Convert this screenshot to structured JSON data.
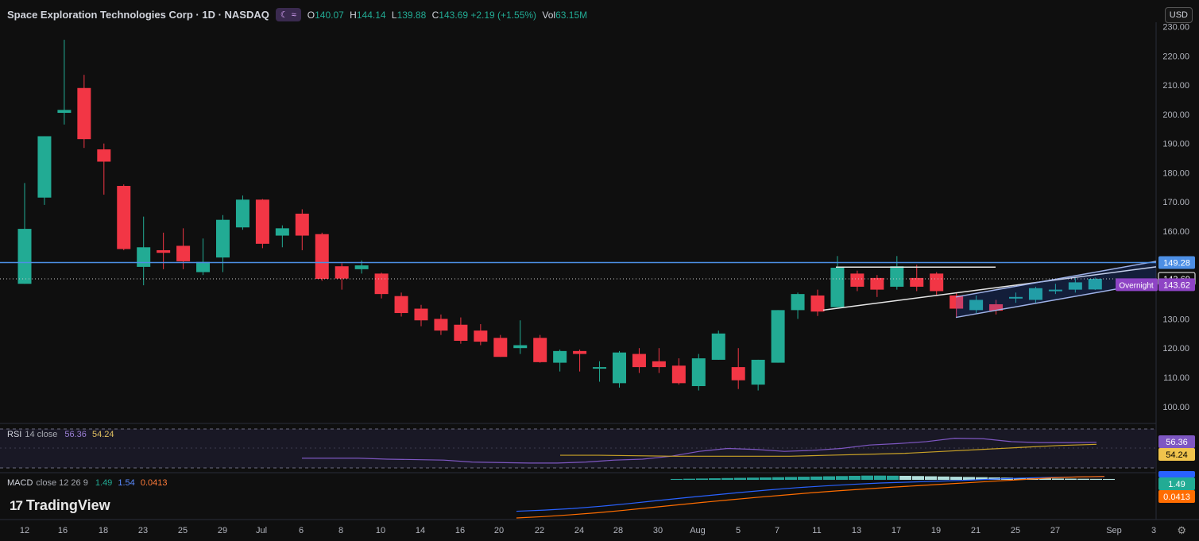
{
  "header": {
    "title": "Space Exploration Technologies Corp · 1D · NASDAQ",
    "ohlc": [
      {
        "k": "O",
        "v": "140.07"
      },
      {
        "k": "H",
        "v": "144.14"
      },
      {
        "k": "L",
        "v": "139.88"
      },
      {
        "k": "C",
        "v": "143.69 +2.19 (+1.55%)"
      },
      {
        "k": "Vol",
        "v": "63.15M"
      }
    ]
  },
  "currency": "USD",
  "brand": "TradingView",
  "rsi": {
    "name": "RSI",
    "params": "14 close",
    "rsi_value": "56.36",
    "ma_value": "54.24"
  },
  "macd": {
    "name": "MACD",
    "params": "close 12 26 9",
    "macd_value": "1.49",
    "signal_value": "1.54",
    "hist_value": "0.0413"
  },
  "colors": {
    "up": "#22ab94",
    "down": "#f23645",
    "level": "#4d8fe5",
    "rsi": "#7e57c2",
    "rsi_ma": "#c9a227",
    "macd": "#2962ff",
    "signal": "#ff6d00"
  },
  "chart_data": {
    "type": "candlestick",
    "ylim": [
      94.5,
      231.5
    ],
    "y_ticks": [
      "230.00",
      "220.00",
      "210.00",
      "200.00",
      "190.00",
      "180.00",
      "170.00",
      "160.00",
      "150.00",
      "130.00",
      "120.00",
      "110.00",
      "100.00"
    ],
    "x_ticks": [
      "12",
      "16",
      "18",
      "23",
      "25",
      "29",
      "Jul",
      "6",
      "8",
      "10",
      "14",
      "16",
      "20",
      "22",
      "24",
      "28",
      "30",
      "Aug",
      "5",
      "7",
      "11",
      "13",
      "17",
      "19",
      "21",
      "25",
      "27",
      "Sep",
      "3"
    ],
    "candles": [
      {
        "o": 142.0,
        "h": 176.5,
        "l": 142.0,
        "c": 160.8
      },
      {
        "o": 171.5,
        "h": 192.5,
        "l": 169.0,
        "c": 192.5
      },
      {
        "o": 200.5,
        "h": 225.5,
        "l": 196.5,
        "c": 201.5
      },
      {
        "o": 209.0,
        "h": 213.5,
        "l": 188.5,
        "c": 191.5
      },
      {
        "o": 188.0,
        "h": 190.0,
        "l": 172.5,
        "c": 183.8
      },
      {
        "o": 175.5,
        "h": 176.0,
        "l": 153.5,
        "c": 153.9
      },
      {
        "o": 147.8,
        "h": 165.0,
        "l": 141.5,
        "c": 154.5
      },
      {
        "o": 153.5,
        "h": 159.5,
        "l": 147.0,
        "c": 152.6
      },
      {
        "o": 155.0,
        "h": 161.0,
        "l": 147.0,
        "c": 149.7
      },
      {
        "o": 146.0,
        "h": 157.5,
        "l": 145.0,
        "c": 149.5
      },
      {
        "o": 151.0,
        "h": 165.5,
        "l": 146.0,
        "c": 163.9
      },
      {
        "o": 161.3,
        "h": 172.2,
        "l": 160.5,
        "c": 170.8
      },
      {
        "o": 170.8,
        "h": 171.0,
        "l": 154.2,
        "c": 155.7
      },
      {
        "o": 158.5,
        "h": 162.0,
        "l": 154.5,
        "c": 161.0
      },
      {
        "o": 166.0,
        "h": 167.5,
        "l": 153.5,
        "c": 158.5
      },
      {
        "o": 159.0,
        "h": 159.5,
        "l": 143.0,
        "c": 143.7
      },
      {
        "o": 148.0,
        "h": 149.0,
        "l": 140.0,
        "c": 143.8
      },
      {
        "o": 147.0,
        "h": 150.0,
        "l": 145.5,
        "c": 148.3
      },
      {
        "o": 145.5,
        "h": 145.8,
        "l": 137.0,
        "c": 138.5
      },
      {
        "o": 137.8,
        "h": 139.0,
        "l": 130.8,
        "c": 132.0
      },
      {
        "o": 133.5,
        "h": 134.8,
        "l": 127.5,
        "c": 129.5
      },
      {
        "o": 130.0,
        "h": 131.5,
        "l": 124.5,
        "c": 126.0
      },
      {
        "o": 128.0,
        "h": 130.5,
        "l": 121.5,
        "c": 122.5
      },
      {
        "o": 126.0,
        "h": 128.2,
        "l": 121.0,
        "c": 122.2
      },
      {
        "o": 123.5,
        "h": 124.5,
        "l": 117.0,
        "c": 117.0
      },
      {
        "o": 120.0,
        "h": 129.5,
        "l": 118.0,
        "c": 121.0
      },
      {
        "o": 123.5,
        "h": 124.5,
        "l": 115.0,
        "c": 115.2
      },
      {
        "o": 115.0,
        "h": 119.5,
        "l": 112.0,
        "c": 119.0
      },
      {
        "o": 119.0,
        "h": 119.5,
        "l": 112.0,
        "c": 118.0
      },
      {
        "o": 113.5,
        "h": 115.5,
        "l": 108.5,
        "c": 113.5
      },
      {
        "o": 108.0,
        "h": 119.0,
        "l": 106.5,
        "c": 118.5
      },
      {
        "o": 118.0,
        "h": 120.0,
        "l": 111.5,
        "c": 113.5
      },
      {
        "o": 115.5,
        "h": 120.0,
        "l": 111.5,
        "c": 113.5
      },
      {
        "o": 114.0,
        "h": 116.5,
        "l": 107.5,
        "c": 108.0
      },
      {
        "o": 107.0,
        "h": 118.0,
        "l": 105.5,
        "c": 116.5
      },
      {
        "o": 116.0,
        "h": 126.0,
        "l": 116.0,
        "c": 125.0
      },
      {
        "o": 113.5,
        "h": 120.0,
        "l": 106.0,
        "c": 109.0
      },
      {
        "o": 107.5,
        "h": 116.0,
        "l": 105.5,
        "c": 116.0
      },
      {
        "o": 115.0,
        "h": 133.0,
        "l": 115.0,
        "c": 133.0
      },
      {
        "o": 133.0,
        "h": 139.0,
        "l": 130.0,
        "c": 138.5
      },
      {
        "o": 138.0,
        "h": 140.0,
        "l": 131.0,
        "c": 132.5
      },
      {
        "o": 134.0,
        "h": 151.5,
        "l": 134.0,
        "c": 147.5
      },
      {
        "o": 145.5,
        "h": 146.5,
        "l": 139.5,
        "c": 141.0
      },
      {
        "o": 144.0,
        "h": 145.0,
        "l": 137.5,
        "c": 140.0
      },
      {
        "o": 141.0,
        "h": 151.5,
        "l": 140.0,
        "c": 148.0
      },
      {
        "o": 144.0,
        "h": 148.5,
        "l": 139.5,
        "c": 141.0
      },
      {
        "o": 145.5,
        "h": 146.0,
        "l": 138.0,
        "c": 139.5
      },
      {
        "o": 138.0,
        "h": 139.0,
        "l": 130.5,
        "c": 133.5
      },
      {
        "o": 133.0,
        "h": 138.0,
        "l": 132.0,
        "c": 136.5
      },
      {
        "o": 135.0,
        "h": 136.5,
        "l": 131.5,
        "c": 132.8
      },
      {
        "o": 137.0,
        "h": 139.0,
        "l": 135.5,
        "c": 137.5
      },
      {
        "o": 136.5,
        "h": 141.0,
        "l": 135.5,
        "c": 140.5
      },
      {
        "o": 139.5,
        "h": 142.0,
        "l": 138.5,
        "c": 140.0
      },
      {
        "o": 140.0,
        "h": 144.0,
        "l": 139.0,
        "c": 142.5
      },
      {
        "o": 140.07,
        "h": 144.14,
        "l": 139.88,
        "c": 143.69
      }
    ],
    "levels": [
      {
        "label": "149.28",
        "value": 149.28,
        "kind": "line",
        "color": "#4d8fe5"
      },
      {
        "label": "143.69",
        "value": 143.69,
        "kind": "dotted",
        "color": "#ffffff"
      },
      {
        "label": "143.62",
        "value": 141.7,
        "kind": "tag",
        "color": "#8e44c5",
        "note": "Overnight"
      }
    ],
    "rsi": [
      40,
      40,
      40,
      39,
      38.5,
      38,
      36,
      35.5,
      35,
      35,
      36,
      38,
      39,
      42,
      47,
      50,
      49,
      47,
      48,
      50,
      53.5,
      55,
      57,
      60.5,
      60,
      57,
      56,
      56,
      56.36
    ],
    "rsi_ma": [
      43,
      43,
      42.5,
      42,
      42,
      42,
      42,
      43,
      44,
      45,
      47,
      49,
      51,
      53,
      54.24
    ],
    "rsi_ylim": [
      30,
      70
    ],
    "macd_hist": [
      0.4,
      0.5,
      0.6,
      0.7,
      0.8,
      0.9,
      1.0,
      1.1,
      1.2,
      1.3,
      1.4,
      1.5,
      1.6,
      1.7,
      1.8,
      1.9,
      1.9,
      1.85,
      1.8,
      1.7,
      1.6,
      1.5,
      1.4,
      1.3,
      1.2,
      1.1,
      1.0,
      0.9,
      0.8,
      0.7,
      0.6,
      0.55,
      0.5,
      0.45,
      0.4
    ],
    "macd_line": [
      -14,
      -13.5,
      -12.8,
      -11.8,
      -10.6,
      -9.3,
      -8,
      -6.8,
      -5.6,
      -4.5,
      -3.5,
      -2.7,
      -2,
      -1.4,
      -1,
      -0.6,
      -0.2,
      0.3,
      0.8,
      1.1,
      1.3,
      1.49
    ],
    "signal_line": [
      -17,
      -16.4,
      -15.6,
      -14.7,
      -13.6,
      -12.4,
      -11.2,
      -10,
      -8.9,
      -7.8,
      -6.8,
      -5.8,
      -4.9,
      -4.1,
      -3.3,
      -2.6,
      -1.9,
      -1.2,
      -0.5,
      0.2,
      0.9,
      1.3,
      1.54
    ],
    "macd_ylim": [
      -17,
      2.5
    ]
  }
}
